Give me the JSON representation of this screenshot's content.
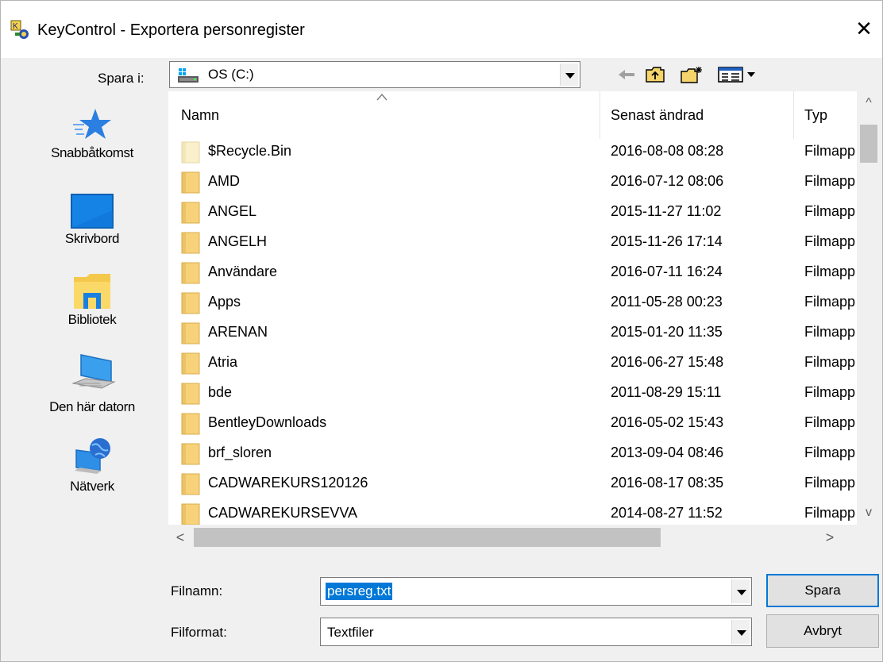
{
  "window": {
    "title": "KeyControl - Exportera personregister",
    "close_glyph": "✕"
  },
  "save_in": {
    "label": "Spara i:",
    "value": "OS (C:)",
    "icon": "drive-icon"
  },
  "toolbar": {
    "back": "back-arrow-icon",
    "up": "up-folder-icon",
    "new_folder": "new-folder-icon",
    "view": "view-menu-icon"
  },
  "places": [
    {
      "label": "Snabbåtkomst",
      "icon": "star-icon"
    },
    {
      "label": "Skrivbord",
      "icon": "desktop-icon"
    },
    {
      "label": "Bibliotek",
      "icon": "library-icon"
    },
    {
      "label": "Den här datorn",
      "icon": "computer-icon"
    },
    {
      "label": "Nätverk",
      "icon": "network-icon"
    }
  ],
  "columns": {
    "name": "Namn",
    "modified": "Senast ändrad",
    "type": "Typ"
  },
  "files": [
    {
      "name": "$Recycle.Bin",
      "modified": "2016-08-08 08:28",
      "type": "Filmapp",
      "hidden": true
    },
    {
      "name": "AMD",
      "modified": "2016-07-12 08:06",
      "type": "Filmapp"
    },
    {
      "name": "ANGEL",
      "modified": "2015-11-27 11:02",
      "type": "Filmapp"
    },
    {
      "name": "ANGELH",
      "modified": "2015-11-26 17:14",
      "type": "Filmapp"
    },
    {
      "name": "Användare",
      "modified": "2016-07-11 16:24",
      "type": "Filmapp"
    },
    {
      "name": "Apps",
      "modified": "2011-05-28 00:23",
      "type": "Filmapp"
    },
    {
      "name": "ARENAN",
      "modified": "2015-01-20 11:35",
      "type": "Filmapp"
    },
    {
      "name": "Atria",
      "modified": "2016-06-27 15:48",
      "type": "Filmapp"
    },
    {
      "name": "bde",
      "modified": "2011-08-29 15:11",
      "type": "Filmapp"
    },
    {
      "name": "BentleyDownloads",
      "modified": "2016-05-02 15:43",
      "type": "Filmapp"
    },
    {
      "name": "brf_sloren",
      "modified": "2013-09-04 08:46",
      "type": "Filmapp"
    },
    {
      "name": "CADWAREKURS120126",
      "modified": "2016-08-17 08:35",
      "type": "Filmapp"
    },
    {
      "name": "CADWAREKURSEVVA",
      "modified": "2014-08-27 11:52",
      "type": "Filmapp"
    }
  ],
  "filename": {
    "label": "Filnamn:",
    "value": "persreg.txt"
  },
  "fileformat": {
    "label": "Filformat:",
    "value": "Textfiler"
  },
  "buttons": {
    "save": "Spara",
    "cancel": "Avbryt"
  }
}
